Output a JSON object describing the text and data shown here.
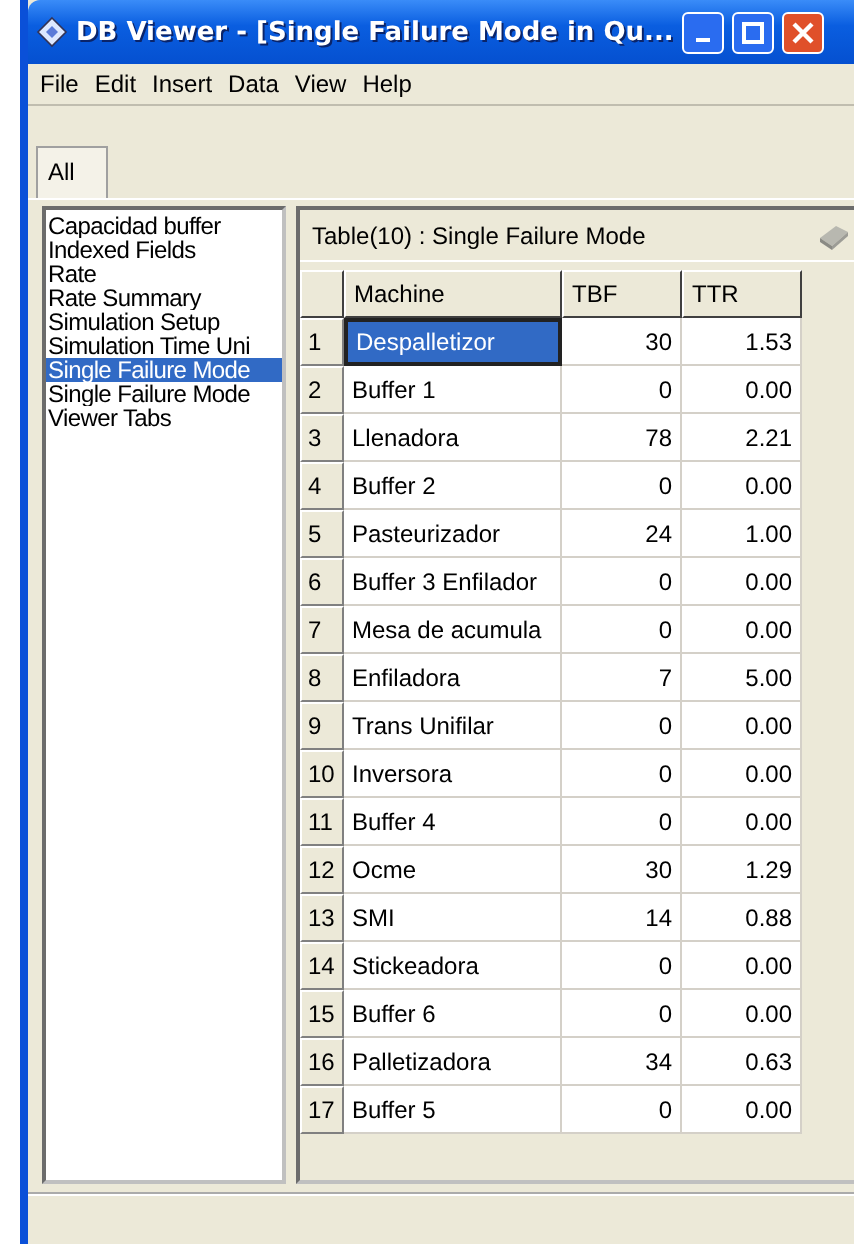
{
  "window": {
    "title": "DB Viewer - [Single Failure Mode in Qu..."
  },
  "menu": [
    "File",
    "Edit",
    "Insert",
    "Data",
    "View",
    "Help"
  ],
  "tabs": [
    {
      "label": "All",
      "selected": true
    }
  ],
  "sidebar": {
    "items": [
      {
        "label": "Capacidad buffer",
        "selected": false
      },
      {
        "label": "Indexed Fields",
        "selected": false
      },
      {
        "label": "Rate",
        "selected": false
      },
      {
        "label": "Rate Summary",
        "selected": false
      },
      {
        "label": "Simulation Setup",
        "selected": false
      },
      {
        "label": "Simulation Time Uni",
        "selected": false
      },
      {
        "label": "Single Failure Mode",
        "selected": true
      },
      {
        "label": "Single Failure Mode",
        "selected": false
      },
      {
        "label": "Viewer Tabs",
        "selected": false
      }
    ]
  },
  "table": {
    "title": "Table(10) : Single Failure Mode",
    "columns": [
      "Machine",
      "TBF",
      "TTR"
    ],
    "rows": [
      {
        "index": "1",
        "machine": "Despalletizor",
        "tbf": "30",
        "ttr": "1.53",
        "selected": true
      },
      {
        "index": "2",
        "machine": "Buffer 1",
        "tbf": "0",
        "ttr": "0.00",
        "selected": false
      },
      {
        "index": "3",
        "machine": "Llenadora",
        "tbf": "78",
        "ttr": "2.21",
        "selected": false
      },
      {
        "index": "4",
        "machine": "Buffer 2",
        "tbf": "0",
        "ttr": "0.00",
        "selected": false
      },
      {
        "index": "5",
        "machine": "Pasteurizador",
        "tbf": "24",
        "ttr": "1.00",
        "selected": false
      },
      {
        "index": "6",
        "machine": "Buffer 3 Enfilador",
        "tbf": "0",
        "ttr": "0.00",
        "selected": false
      },
      {
        "index": "7",
        "machine": "Mesa de acumula",
        "tbf": "0",
        "ttr": "0.00",
        "selected": false
      },
      {
        "index": "8",
        "machine": "Enfiladora",
        "tbf": "7",
        "ttr": "5.00",
        "selected": false
      },
      {
        "index": "9",
        "machine": "Trans Unifilar",
        "tbf": "0",
        "ttr": "0.00",
        "selected": false
      },
      {
        "index": "10",
        "machine": "Inversora",
        "tbf": "0",
        "ttr": "0.00",
        "selected": false
      },
      {
        "index": "11",
        "machine": "Buffer 4",
        "tbf": "0",
        "ttr": "0.00",
        "selected": false
      },
      {
        "index": "12",
        "machine": "Ocme",
        "tbf": "30",
        "ttr": "1.29",
        "selected": false
      },
      {
        "index": "13",
        "machine": "SMI",
        "tbf": "14",
        "ttr": "0.88",
        "selected": false
      },
      {
        "index": "14",
        "machine": "Stickeadora",
        "tbf": "0",
        "ttr": "0.00",
        "selected": false
      },
      {
        "index": "15",
        "machine": "Buffer 6",
        "tbf": "0",
        "ttr": "0.00",
        "selected": false
      },
      {
        "index": "16",
        "machine": "Palletizadora",
        "tbf": "34",
        "ttr": "0.63",
        "selected": false
      },
      {
        "index": "17",
        "machine": "Buffer 5",
        "tbf": "0",
        "ttr": "0.00",
        "selected": false
      }
    ]
  }
}
